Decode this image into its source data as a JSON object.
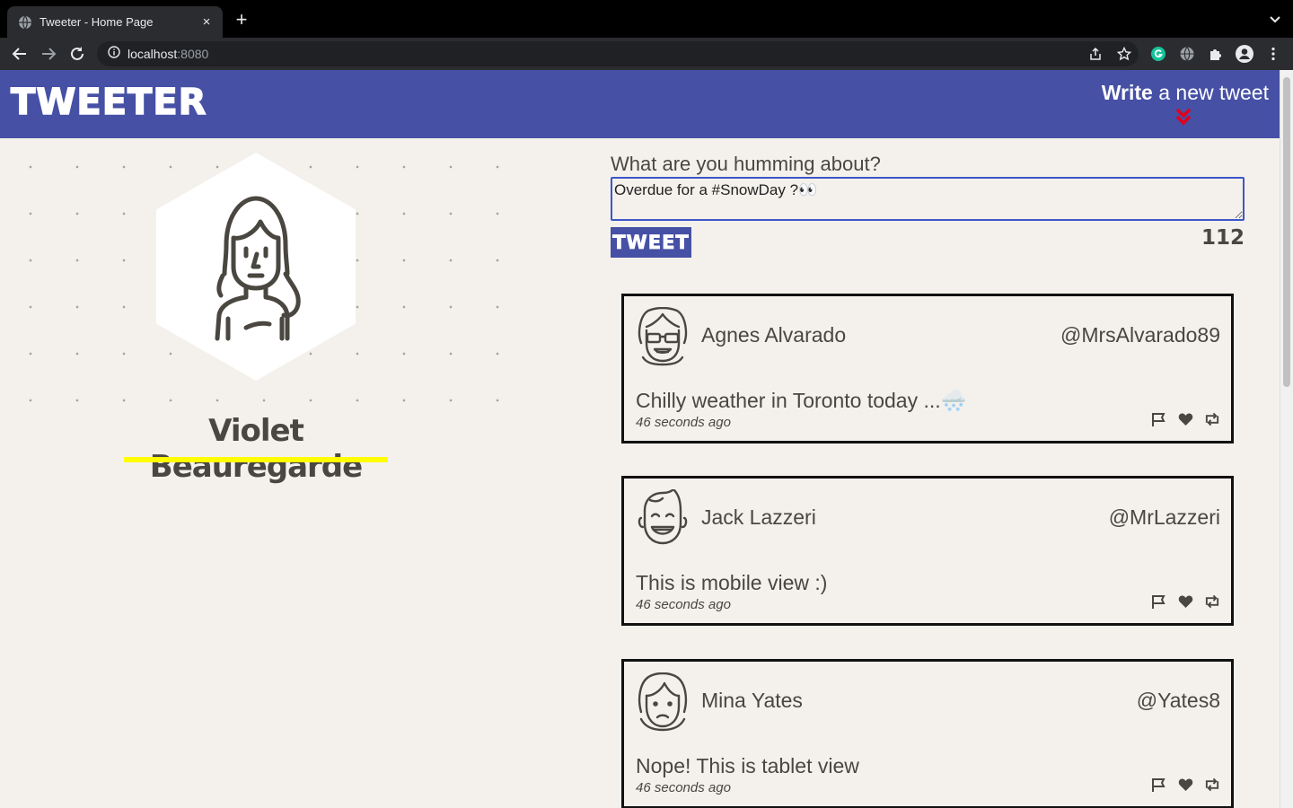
{
  "browser": {
    "tab_title": "Tweeter - Home Page",
    "tab_close": "×",
    "new_tab": "+",
    "url_host": "localhost",
    "url_port": ":8080"
  },
  "navbar": {
    "logo": "TWEETER",
    "compose_bold": "Write",
    "compose_rest": " a new tweet"
  },
  "profile": {
    "name": "Violet Beauregarde"
  },
  "compose": {
    "label": "What are you humming about?",
    "value": "Overdue for a #SnowDay ?👀",
    "button_label": "TWEET",
    "counter": "112"
  },
  "tweets": [
    {
      "name": "Agnes Alvarado",
      "handle": "@MrsAlvarado89",
      "content": "Chilly weather in Toronto today ...🌨️",
      "time": "46 seconds ago",
      "avatar_icon": "woman-sunglasses-avatar-icon"
    },
    {
      "name": "Jack Lazzeri",
      "handle": "@MrLazzeri",
      "content": "This is mobile view :)",
      "time": "46 seconds ago",
      "avatar_icon": "smiling-man-avatar-icon"
    },
    {
      "name": "Mina Yates",
      "handle": "@Yates8",
      "content": "Nope! This is tablet view",
      "time": "46 seconds ago",
      "avatar_icon": "sad-woman-avatar-icon"
    }
  ],
  "colors": {
    "navbar": "#4650a5",
    "background": "#f4f1ec",
    "text": "#4a4640",
    "underline": "#ffff00",
    "arrow": "#e0001b",
    "input_border": "#3c56c9"
  }
}
